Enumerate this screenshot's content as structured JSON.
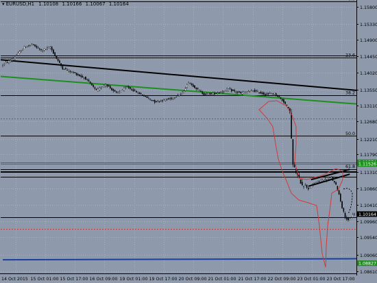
{
  "window": {
    "symbol": "EURUSD,H1",
    "ohlc": [
      "1.10108",
      "1.10166",
      "1.10067",
      "1.10164"
    ]
  },
  "colors": {
    "background": "#8e9aab",
    "grid": "#a6b0bd",
    "axis": "#000000",
    "candle_bull": "#ffffff",
    "candle_bear": "#000000",
    "hline": "#000000",
    "trendline": "#000000",
    "green_line": "#1d8f1d",
    "red_dotted": "#c23a3a",
    "blue_line": "#1a3fa0",
    "price_label_bg": "#000000",
    "green_label_bg": "#1d8f1d"
  },
  "chart_data": {
    "type": "candlestick",
    "symbol": "EURUSD",
    "timeframe": "H1",
    "ylim": [
      1.0855,
      1.1595
    ],
    "y_ticks": [
      "1.15800",
      "1.15330",
      "1.14900",
      "1.14450",
      "1.14020",
      "1.13550",
      "1.13110",
      "1.12680",
      "1.12210",
      "1.11790",
      "1.11310",
      "1.10860",
      "1.10410",
      "1.09960",
      "1.09540",
      "1.09060",
      "1.08610"
    ],
    "x_ticks": [
      "14 Oct 2015",
      "15 Oct 01:00",
      "15 Oct 17:00",
      "16 Oct 09:00",
      "19 Oct 01:00",
      "19 Oct 17:00",
      "20 Oct 09:00",
      "21 Oct 01:00",
      "21 Oct 17:00",
      "22 Oct 09:00",
      "23 Oct 01:00",
      "23 Oct 17:00"
    ],
    "current_price": "1.10164",
    "price_labels": [
      {
        "text": "1.11574",
        "price": 1.11574,
        "style": "green"
      },
      {
        "text": "1.11526",
        "price": 1.11526,
        "style": "green"
      },
      {
        "text": "1.08827",
        "price": 1.08827,
        "style": "green"
      },
      {
        "text": "1.10164",
        "price": 1.10164,
        "style": "black"
      }
    ],
    "fib_labels": [
      {
        "text": "0.0",
        "price": 1.1595
      },
      {
        "text": "23.6",
        "price": 1.1442
      },
      {
        "text": "38.2",
        "price": 1.134
      },
      {
        "text": "50.0",
        "price": 1.1229
      },
      {
        "text": "61.8",
        "price": 1.1139
      }
    ],
    "horizontal_lines": [
      1.1595,
      1.1448,
      1.1442,
      1.134,
      1.1229,
      1.1139,
      1.1132,
      1.113,
      1.1117,
      1.1007
    ],
    "green_horizontal": [
      1.11574,
      1.11526
    ],
    "red_dotted_horizontal": [
      1.1276,
      1.0977
    ],
    "trendline": {
      "start_bar": 0,
      "start_price": 1.1436,
      "end_bar": 229,
      "end_price": 1.1353
    },
    "green_trendline": {
      "start_bar": 0,
      "start_price": 1.1391,
      "end_bar": 229,
      "end_price": 1.1316
    },
    "channel": {
      "start_bar": 199,
      "start_price": 1.1092,
      "end_bar": 226,
      "end_price": 1.1125
    },
    "blue_line": {
      "start_bar": 0,
      "start_price": 1.0892,
      "end_bar": 229,
      "end_price": 1.0895
    },
    "anchor_points": [
      [
        0,
        1.142
      ],
      [
        8,
        1.144
      ],
      [
        15,
        1.147
      ],
      [
        20,
        1.1478
      ],
      [
        26,
        1.1462
      ],
      [
        32,
        1.147
      ],
      [
        36,
        1.144
      ],
      [
        40,
        1.1413
      ],
      [
        45,
        1.1405
      ],
      [
        55,
        1.1385
      ],
      [
        62,
        1.1352
      ],
      [
        68,
        1.137
      ],
      [
        75,
        1.1345
      ],
      [
        82,
        1.1362
      ],
      [
        92,
        1.134
      ],
      [
        100,
        1.1322
      ],
      [
        110,
        1.133
      ],
      [
        118,
        1.1345
      ],
      [
        122,
        1.1375
      ],
      [
        126,
        1.1362
      ],
      [
        132,
        1.1342
      ],
      [
        140,
        1.1345
      ],
      [
        148,
        1.1355
      ],
      [
        156,
        1.1345
      ],
      [
        164,
        1.1352
      ],
      [
        172,
        1.1342
      ],
      [
        178,
        1.1345
      ],
      [
        182,
        1.133
      ],
      [
        184,
        1.1322
      ],
      [
        186,
        1.131
      ],
      [
        188,
        1.1295
      ],
      [
        189,
        1.122
      ],
      [
        190,
        1.115
      ],
      [
        192,
        1.113
      ],
      [
        194,
        1.111
      ],
      [
        196,
        1.1098
      ],
      [
        198,
        1.1095
      ],
      [
        200,
        1.1085
      ],
      [
        204,
        1.11
      ],
      [
        208,
        1.1108
      ],
      [
        212,
        1.111
      ],
      [
        215,
        1.1115
      ],
      [
        218,
        1.1095
      ],
      [
        220,
        1.107
      ],
      [
        222,
        1.1035
      ],
      [
        224,
        1.1008
      ],
      [
        226,
        1.0998
      ],
      [
        228,
        1.1007
      ],
      [
        229,
        1.1016
      ]
    ]
  }
}
